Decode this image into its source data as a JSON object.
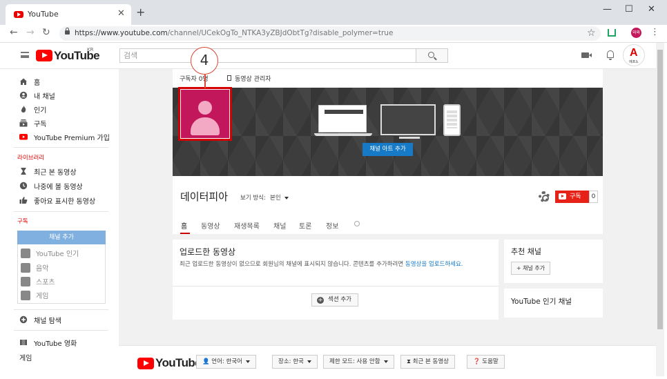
{
  "browser": {
    "tab_title": "YouTube",
    "url_host": "https://www.youtube.com",
    "url_path": "/channel/UCekOgTo_NTKA3yZBJdObtTg?disable_polymer=true",
    "profile_initials": "와와"
  },
  "header": {
    "logo": "YouTube",
    "region": "KR",
    "search_placeholder": "검색",
    "avatar_letter": "A",
    "avatar_label": "에프노"
  },
  "sidebar": {
    "main_items": [
      {
        "label": "홈",
        "icon": "home-icon"
      },
      {
        "label": "내 채널",
        "icon": "account-icon"
      },
      {
        "label": "인기",
        "icon": "flame-icon"
      },
      {
        "label": "구독",
        "icon": "subscriptions-icon"
      },
      {
        "label": "YouTube Premium 가입",
        "icon": "youtube-red-icon"
      }
    ],
    "library_title": "라이브러리",
    "library_items": [
      {
        "label": "최근 본 동영상",
        "icon": "hourglass-icon"
      },
      {
        "label": "나중에 볼 동영상",
        "icon": "clock-icon"
      },
      {
        "label": "좋아요 표시한 동영상",
        "icon": "thumbs-up-icon"
      }
    ],
    "subs_title": "구독",
    "add_channel": "채널 추가",
    "sub_items": [
      "YouTube 인기",
      "음악",
      "스포츠",
      "게임"
    ],
    "browse_channels": "채널 탐색",
    "movies": "YouTube 영화",
    "gaming": "게임"
  },
  "channel": {
    "subscribers": "구독자 0명",
    "video_manager": "동영상 관리자",
    "banner_button": "채널 아트 추가",
    "callout_number": "4",
    "name": "데이터피아",
    "view_as_label": "보기 방식:",
    "view_as_value": "본인",
    "subscribe": "구독",
    "subscribe_count": "0",
    "tabs": [
      "홈",
      "동영상",
      "재생목록",
      "채널",
      "토론",
      "정보"
    ]
  },
  "uploads": {
    "title": "업로드한 동영상",
    "message": "최근 업로드한 동영상이 없으므로 회원님의 채널에 표시되지 않습니다. 콘텐츠를 추가하려면 ",
    "link": "동영상을 업로드하세요.",
    "add_section": "섹션 추가"
  },
  "recommended": {
    "title": "추천 채널",
    "add_channel": "+ 채널 추가",
    "popular_title": "YouTube 인기 채널"
  },
  "footer": {
    "logo": "YouTube",
    "language": "언어: 한국어",
    "location": "장소: 한국",
    "restricted": "제한 모드: 사용 안함",
    "history": "최근 본 동영상",
    "help": "도움말"
  },
  "colors": {
    "brand_red": "#ff0000",
    "subscribe_red": "#e62117",
    "link_blue": "#167ac6",
    "avatar_bg": "#c2185b"
  }
}
